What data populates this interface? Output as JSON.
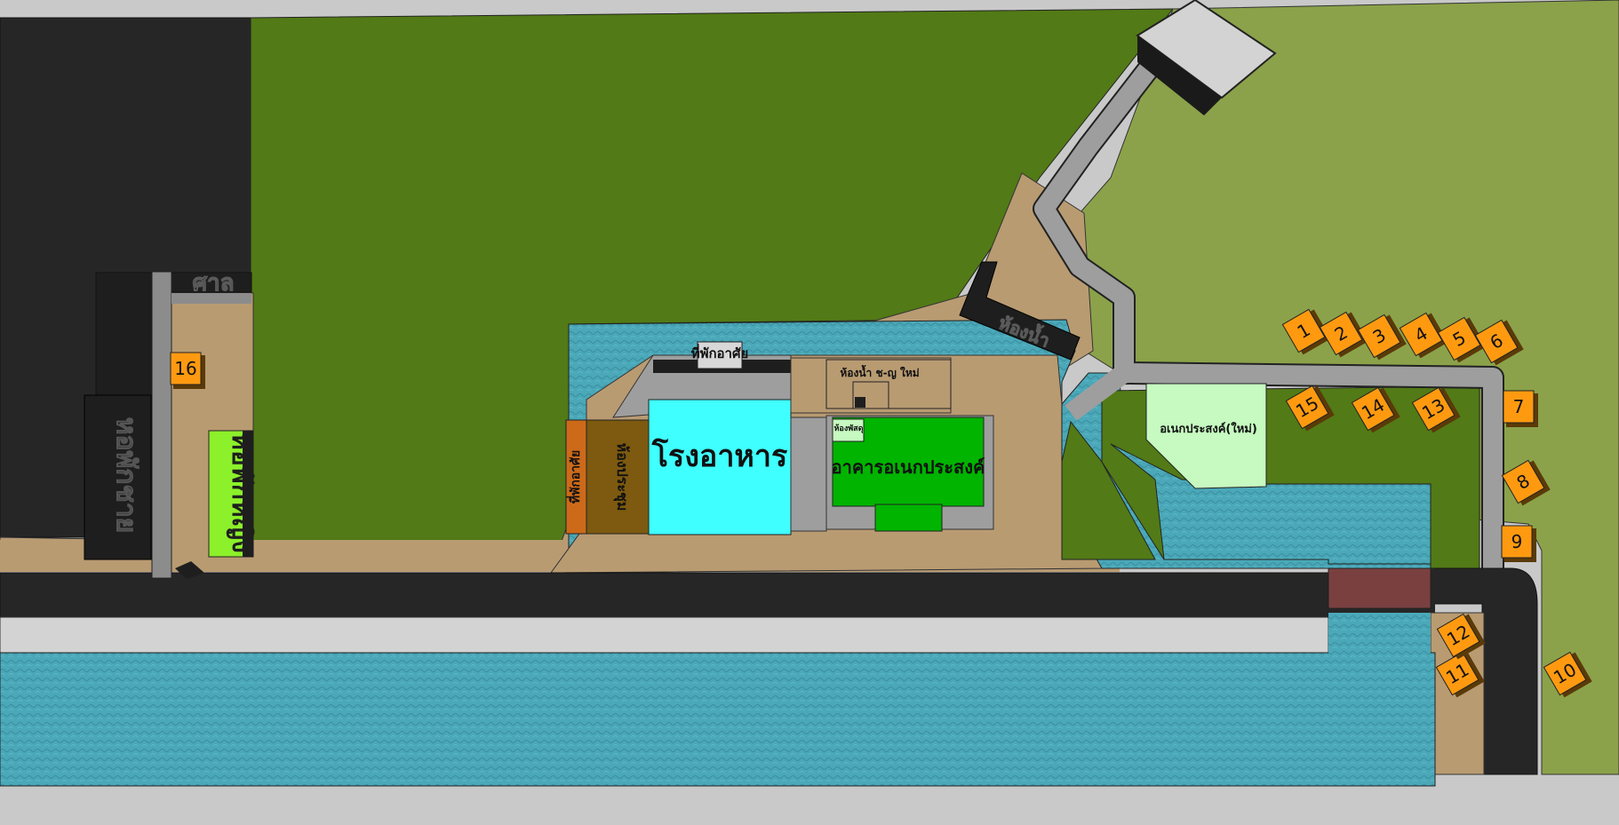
{
  "map": {
    "labels": {
      "sala": "ศาล",
      "dorm_men": "หอพักชาย",
      "dorm_women": "หอพักหญิง",
      "canteen": "โรงอาหาร",
      "multipurpose": "อาคารอเนกประสงค์",
      "multipurpose_new": "อเนกประสงค์(ใหม่)",
      "meeting_room": "ห้องประชุม",
      "shrine_side": "ที่พักอาศัย",
      "shrine_top": "ที่พักอาศัย",
      "restroom": "ห้องน้ำ",
      "restroom_new": "ห้องน้ำ ช-ญ ใหม่",
      "small_room": "ห้องพัสดุ"
    },
    "huts": [
      "1",
      "2",
      "3",
      "4",
      "5",
      "6",
      "7",
      "8",
      "9",
      "10",
      "11",
      "12",
      "13",
      "14",
      "15",
      "16"
    ]
  },
  "colors": {
    "water": "#4aa8b8",
    "grass_dark": "#527a16",
    "grass_light": "#8ba24a",
    "sand": "#b99b72",
    "road": "#262626",
    "path": "#9e9e9e",
    "canteen": "#3fffff",
    "multipurpose": "#00b400",
    "multipurpose_new": "#c6fac0",
    "dorm_women": "#8cf02a",
    "hut": "#ff9a10",
    "meeting": "#7d5a10",
    "shrine": "#cc6a1a",
    "bridge": "#7a4040"
  }
}
